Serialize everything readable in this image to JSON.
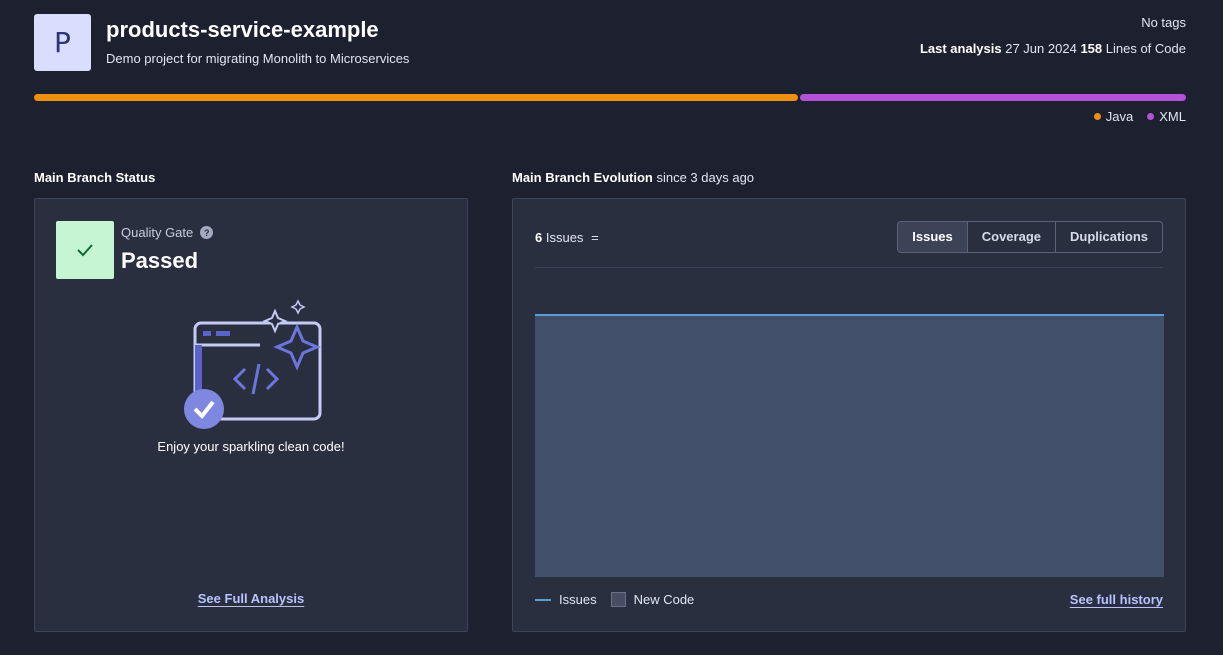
{
  "project": {
    "avatar_letter": "P",
    "name": "products-service-example",
    "description": "Demo project for migrating Monolith to Microservices",
    "tags": "No tags",
    "last_analysis_label": "Last analysis",
    "last_analysis_date": "27 Jun 2024",
    "lines_of_code_count": "158",
    "lines_of_code_label": "Lines of Code"
  },
  "languages": [
    {
      "name": "Java",
      "fraction": 0.664,
      "color": "#ef8f0f"
    },
    {
      "name": "XML",
      "fraction": 0.336,
      "color": "#b352d8"
    }
  ],
  "status": {
    "section_title": "Main Branch Status",
    "quality_gate_label": "Quality Gate",
    "quality_gate_status": "Passed",
    "help_glyph": "?",
    "message": "Enjoy your sparkling clean code!",
    "see_full_analysis": "See Full Analysis"
  },
  "evolution": {
    "section_title": "Main Branch Evolution",
    "since": "since 3 days ago",
    "issues_count": "6",
    "issues_label": "Issues",
    "trend_symbol": "=",
    "tabs": [
      "Issues",
      "Coverage",
      "Duplications"
    ],
    "active_tab": "Issues",
    "legend_issues": "Issues",
    "legend_new_code": "New Code",
    "see_full_history": "See full history",
    "line_color": "#5a9cd6",
    "area_color": "#424f6b"
  }
}
